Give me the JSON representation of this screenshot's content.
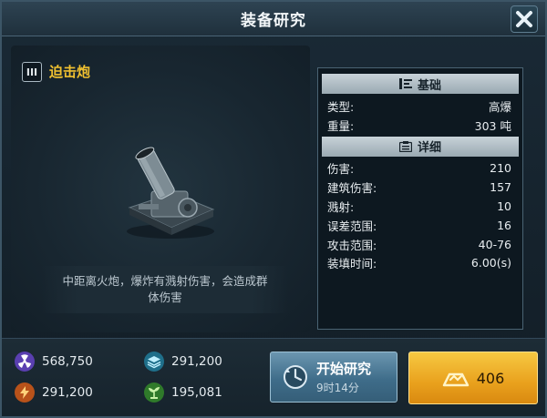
{
  "window": {
    "title": "装备研究"
  },
  "weapon": {
    "tier": "III",
    "name": "迫击炮",
    "description": "中距离火炮，爆炸有溅射伤害，会造成群体伤害"
  },
  "stats": {
    "basic_header": "基础",
    "basic": [
      {
        "label": "类型:",
        "value": "高爆"
      },
      {
        "label": "重量:",
        "value": "303 吨"
      }
    ],
    "detail_header": "详细",
    "detail": [
      {
        "label": "伤害:",
        "value": "210"
      },
      {
        "label": "建筑伤害:",
        "value": "157"
      },
      {
        "label": "溅射:",
        "value": "10"
      },
      {
        "label": "误差范围:",
        "value": "16"
      },
      {
        "label": "攻击范围:",
        "value": "40-76"
      },
      {
        "label": "装填时间:",
        "value": "6.00(s)"
      }
    ]
  },
  "resources": [
    {
      "icon": "radiation-icon",
      "value": "568,750",
      "color": "#7a5cd6"
    },
    {
      "icon": "layers-icon",
      "value": "291,200",
      "color": "#3aa6c8"
    },
    {
      "icon": "lightning-icon",
      "value": "291,200",
      "color": "#e3752a"
    },
    {
      "icon": "plant-icon",
      "value": "195,081",
      "color": "#5dbb4a"
    }
  ],
  "actions": {
    "research_label": "开始研究",
    "research_time": "9时14分",
    "gold_value": "406"
  },
  "colors": {
    "accent_gold": "#f0c030",
    "gold_button": "#f3b52f",
    "research_button": "#4f7d99"
  }
}
